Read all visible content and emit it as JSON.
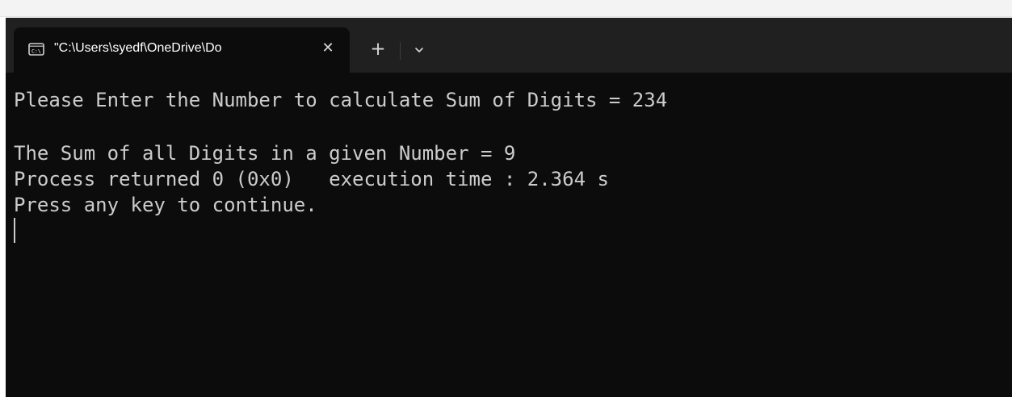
{
  "tabs": [
    {
      "title": "\"C:\\Users\\syedf\\OneDrive\\Do",
      "icon": "console-icon",
      "close_glyph": "✕"
    }
  ],
  "tabbar": {
    "new_tab_glyph": "+",
    "dropdown_icon": "chevron-down-icon"
  },
  "terminal": {
    "lines": [
      "Please Enter the Number to calculate Sum of Digits = 234",
      "",
      "The Sum of all Digits in a given Number = 9",
      "Process returned 0 (0x0)   execution time : 2.364 s",
      "Press any key to continue."
    ]
  },
  "colors": {
    "terminal_background": "#0c0c0c",
    "terminal_text": "#cccccc",
    "tabbar_background": "#202020",
    "tab_text": "#ffffff"
  }
}
